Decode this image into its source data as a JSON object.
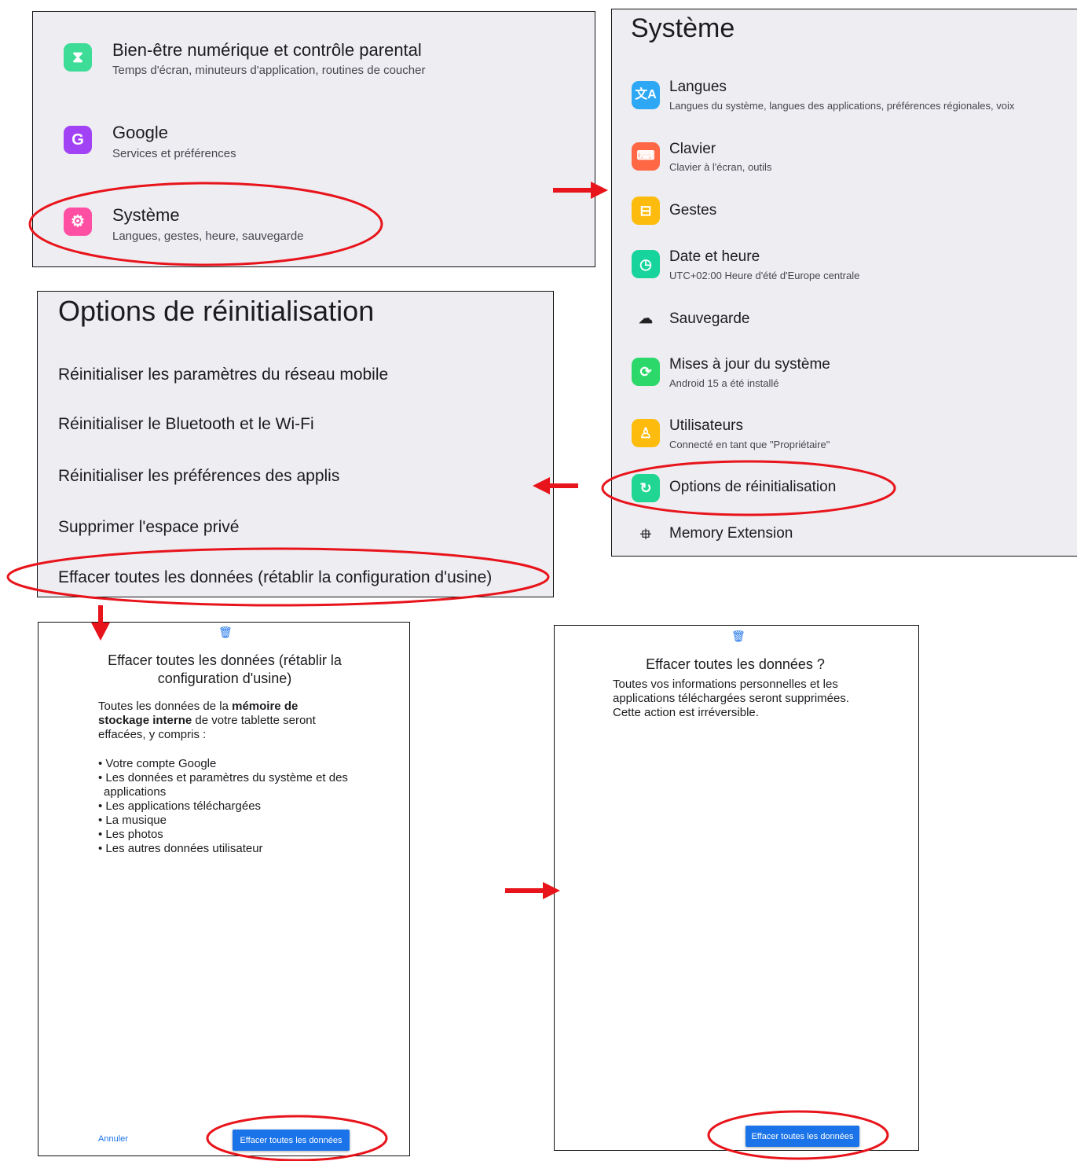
{
  "panel_settings": {
    "items": [
      {
        "title": "Bien-être numérique et contrôle parental",
        "subtitle": "Temps d'écran, minuteurs d'application, routines de coucher",
        "icon": "hourglass-icon",
        "color": "#3ddc97"
      },
      {
        "title": "Google",
        "subtitle": "Services et préférences",
        "icon": "google-g-icon",
        "color": "#a142f4"
      },
      {
        "title": "Système",
        "subtitle": "Langues, gestes, heure, sauvegarde",
        "icon": "system-gear-icon",
        "color": "#ff4fa3"
      }
    ]
  },
  "panel_systeme": {
    "title": "Système",
    "items": [
      {
        "title": "Langues",
        "subtitle": "Langues du système, langues des applications, préférences régionales, voix",
        "icon": "translate-icon",
        "color": "#2ea8f5"
      },
      {
        "title": "Clavier",
        "subtitle": "Clavier à l'écran, outils",
        "icon": "keyboard-icon",
        "color": "#ff6745"
      },
      {
        "title": "Gestes",
        "subtitle": "",
        "icon": "gestures-icon",
        "color": "#fdbc0d"
      },
      {
        "title": "Date et heure",
        "subtitle": "UTC+02:00 Heure d'été d'Europe centrale",
        "icon": "clock-icon",
        "color": "#17d39c"
      },
      {
        "title": "Sauvegarde",
        "subtitle": "",
        "icon": "cloud-backup-icon",
        "color": "transparent"
      },
      {
        "title": "Mises à jour du système",
        "subtitle": "Android 15 a été installé",
        "icon": "system-update-icon",
        "color": "#2cd86a"
      },
      {
        "title": "Utilisateurs",
        "subtitle": "Connecté en tant que \"Propriétaire\"",
        "icon": "user-icon",
        "color": "#fdbc0d"
      },
      {
        "title": "Options de réinitialisation",
        "subtitle": "",
        "icon": "reset-icon",
        "color": "#20d692"
      },
      {
        "title": "Memory Extension",
        "subtitle": "",
        "icon": "chip-icon",
        "color": "transparent"
      }
    ]
  },
  "panel_reset": {
    "title": "Options de réinitialisation",
    "options": [
      "Réinitialiser les paramètres du réseau mobile",
      "Réinitialiser le Bluetooth et le Wi-Fi",
      "Réinitialiser les préférences des applis",
      "Supprimer l'espace privé",
      "Effacer toutes les données (rétablir la configuration d'usine)"
    ]
  },
  "panel_erase": {
    "title": "Effacer toutes les données (rétablir la configuration d'usine)",
    "intro_1": "Toutes les données de la ",
    "intro_bold": "mémoire de stockage interne",
    "intro_2": " de votre tablette seront effacées, y compris :",
    "list": [
      "• Votre compte Google",
      "• Les données et paramètres du système et des applications",
      "• Les applications téléchargées",
      "• La musique",
      "• Les photos",
      "• Les autres données utilisateur"
    ],
    "cancel_label": "Annuler",
    "confirm_label": "Effacer toutes les données"
  },
  "panel_confirm": {
    "title": "Effacer toutes les données ?",
    "body": "Toutes vos informations personnelles et les applications téléchargées seront supprimées. Cette action est irréversible.",
    "confirm_label": "Effacer toutes les données"
  },
  "annotation_colors": {
    "highlight": "#e8141b",
    "arrow": "#e8141b"
  }
}
